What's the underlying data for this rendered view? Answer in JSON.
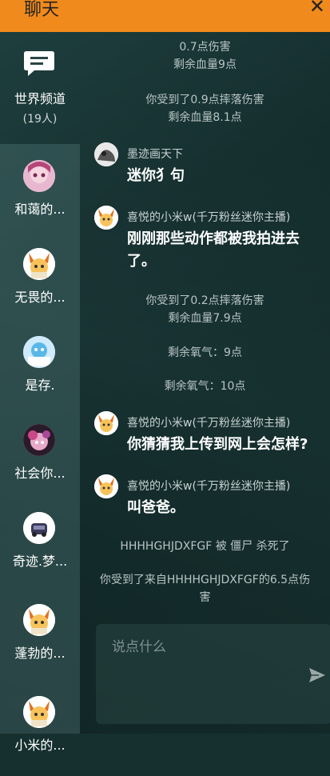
{
  "header": {
    "title": "聊天",
    "close_glyph": "✕"
  },
  "world_channel": {
    "label": "世界频道",
    "count": "(19人)",
    "icon": "chat-bubble-icon"
  },
  "channels": [
    {
      "name": "和蔼的...",
      "avatar": "anime-girl-avatar"
    },
    {
      "name": "无畏的...",
      "avatar": "fox-avatar"
    },
    {
      "name": "是存.",
      "avatar": "sky-avatar"
    },
    {
      "name": "社会你...",
      "avatar": "anime-avatar"
    },
    {
      "name": "奇迹.梦...",
      "avatar": "car-avatar"
    },
    {
      "name": "蓬勃的...",
      "avatar": "fox-avatar"
    },
    {
      "name": "小米的...",
      "avatar": "fox-avatar"
    }
  ],
  "messages": [
    {
      "kind": "system",
      "lines": [
        "0.7点伤害",
        "剩余血量9点"
      ]
    },
    {
      "kind": "system",
      "lines": [
        "你受到了0.9点摔落伤害",
        "剩余血量8.1点"
      ]
    },
    {
      "kind": "user",
      "user": "墨迹画天下",
      "text": [
        "迷你犭句"
      ],
      "avatar": "ink-avatar"
    },
    {
      "kind": "user",
      "user": "喜悦的小米w(千万粉丝迷你主播)",
      "text": [
        "刚刚那些动作都被我拍进去",
        "了。"
      ],
      "avatar": "fox-avatar"
    },
    {
      "kind": "system",
      "lines": [
        "你受到了0.2点摔落伤害",
        "剩余血量7.9点"
      ]
    },
    {
      "kind": "system",
      "lines": [
        "剩余氧气：9点"
      ]
    },
    {
      "kind": "system",
      "lines": [
        "剩余氧气：10点"
      ]
    },
    {
      "kind": "user",
      "user": "喜悦的小米w(千万粉丝迷你主播)",
      "text": [
        "你猜猜我上传到网上会怎样?"
      ],
      "avatar": "fox-avatar"
    },
    {
      "kind": "user",
      "user": "喜悦的小米w(千万粉丝迷你主播)",
      "text": [
        "叫爸爸。"
      ],
      "avatar": "fox-avatar"
    },
    {
      "kind": "system",
      "lines": [
        "HHHHGHJDXFGF 被 僵尸 杀死了"
      ]
    },
    {
      "kind": "system",
      "lines": [
        "你受到了来自HHHHGHJDXFGF的6.5点伤",
        "害"
      ]
    }
  ],
  "input": {
    "placeholder": "说点什么",
    "send_icon": "send-icon"
  },
  "colors": {
    "header": "#f08a1c",
    "text": "#ffffff",
    "system_text": "#b8c4c4"
  }
}
